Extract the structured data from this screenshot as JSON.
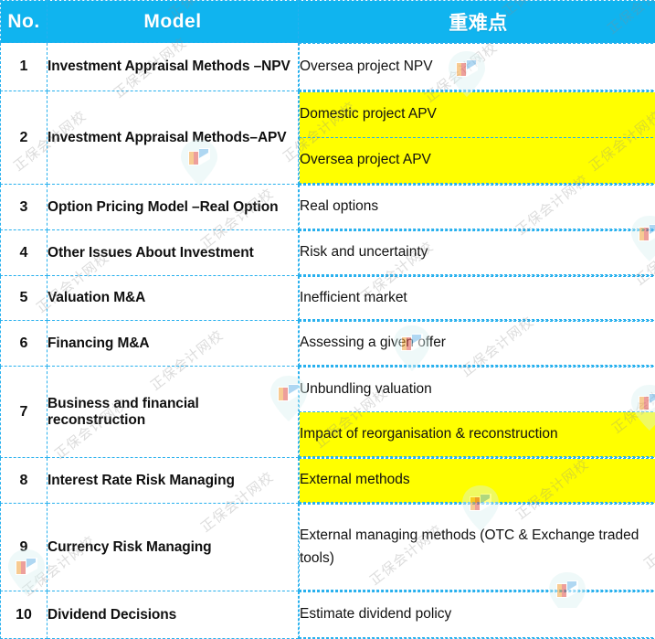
{
  "document": {
    "title": "Model / 重难点 summary table",
    "accent_color": "#10b4ef",
    "highlight_color": "#ffff00",
    "border_color": "#27b0ee"
  },
  "watermark": {
    "text": "正保会计网校",
    "logo_name": "book-flag-logo"
  },
  "table": {
    "headers": {
      "no": "No.",
      "model": "Model",
      "key_points": "重难点"
    },
    "rows": [
      {
        "no": "1",
        "model": "Investment Appraisal Methods –NPV",
        "points": [
          {
            "text": "Oversea project NPV",
            "highlight": false
          }
        ]
      },
      {
        "no": "2",
        "model": "Investment Appraisal Methods–APV",
        "points": [
          {
            "text": "Domestic project APV",
            "highlight": true
          },
          {
            "text": "Oversea project APV",
            "highlight": true
          }
        ]
      },
      {
        "no": "3",
        "model": "Option Pricing Model –Real Option",
        "points": [
          {
            "text": "Real options",
            "highlight": false
          }
        ]
      },
      {
        "no": "4",
        "model": "Other Issues About Investment",
        "points": [
          {
            "text": "Risk and uncertainty",
            "highlight": false
          }
        ]
      },
      {
        "no": "5",
        "model": "Valuation M&A",
        "points": [
          {
            "text": "Inefficient market",
            "highlight": false
          }
        ]
      },
      {
        "no": "6",
        "model": "Financing M&A",
        "points": [
          {
            "text": "Assessing a given offer",
            "highlight": false
          }
        ]
      },
      {
        "no": "7",
        "model": "Business and financial reconstruction",
        "points": [
          {
            "text": "Unbundling valuation",
            "highlight": false
          },
          {
            "text": "Impact of reorganisation & reconstruction",
            "highlight": true
          }
        ]
      },
      {
        "no": "8",
        "model": "Interest Rate Risk Managing",
        "points": [
          {
            "text": "External methods",
            "highlight": true
          }
        ]
      },
      {
        "no": "9",
        "model": "Currency Risk Managing",
        "points": [
          {
            "text": "External managing methods (OTC & Exchange traded tools)",
            "highlight": false
          }
        ]
      },
      {
        "no": "10",
        "model": "Dividend Decisions",
        "points": [
          {
            "text": "Estimate dividend policy",
            "highlight": false
          }
        ]
      }
    ]
  }
}
